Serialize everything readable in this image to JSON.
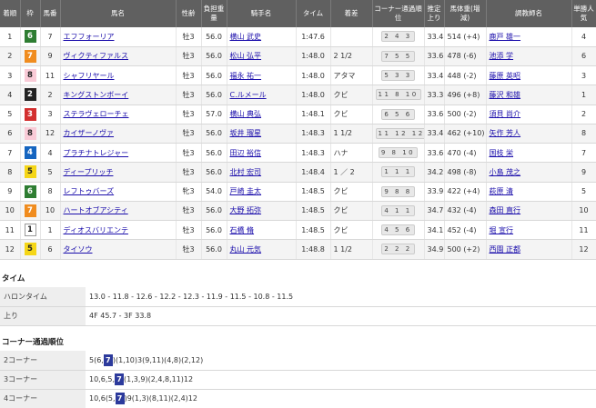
{
  "headers": [
    "着順",
    "枠",
    "馬番",
    "馬名",
    "性齢",
    "負担重量",
    "騎手名",
    "タイム",
    "着差",
    "コーナー通過順位",
    "推定上り",
    "馬体重(増減)",
    "調教師名",
    "単勝人気"
  ],
  "rows": [
    {
      "rank": "1",
      "frame": "6",
      "num": "7",
      "horse": "エフフォーリア",
      "sexage": "牡3",
      "weight": "56.0",
      "jockey": "横山 武史",
      "time": "1:47.6",
      "margin": "",
      "corner": "2 4 3",
      "last": "33.4",
      "body": "514 (+4)",
      "trainer": "鹿戸 雄一",
      "pop": "4"
    },
    {
      "rank": "2",
      "frame": "7",
      "num": "9",
      "horse": "ヴィクティファルス",
      "sexage": "牡3",
      "weight": "56.0",
      "jockey": "松山 弘平",
      "time": "1:48.0",
      "margin": "2 1/2",
      "corner": "7 5 5",
      "last": "33.6",
      "body": "478 (-6)",
      "trainer": "池添 学",
      "pop": "6"
    },
    {
      "rank": "3",
      "frame": "8",
      "num": "11",
      "horse": "シャフリヤール",
      "sexage": "牡3",
      "weight": "56.0",
      "jockey": "福永 祐一",
      "time": "1:48.0",
      "margin": "アタマ",
      "corner": "5 3 3",
      "last": "33.4",
      "body": "448 (-2)",
      "trainer": "藤原 英昭",
      "pop": "3"
    },
    {
      "rank": "4",
      "frame": "2",
      "num": "2",
      "horse": "キングストンボーイ",
      "sexage": "牡3",
      "weight": "56.0",
      "jockey": "C.ルメール",
      "time": "1:48.0",
      "margin": "クビ",
      "corner": "11 8 10",
      "last": "33.3",
      "body": "496 (+8)",
      "trainer": "藤沢 和雄",
      "pop": "1"
    },
    {
      "rank": "5",
      "frame": "3",
      "num": "3",
      "horse": "ステラヴェローチェ",
      "sexage": "牡3",
      "weight": "57.0",
      "jockey": "横山 典弘",
      "time": "1:48.1",
      "margin": "クビ",
      "corner": "6 5 6",
      "last": "33.6",
      "body": "500 (-2)",
      "trainer": "須貝 尚介",
      "pop": "2"
    },
    {
      "rank": "6",
      "frame": "8",
      "num": "12",
      "horse": "カイザーノヴァ",
      "sexage": "牡3",
      "weight": "56.0",
      "jockey": "坂井 瑠星",
      "time": "1:48.3",
      "margin": "1 1/2",
      "corner": "11 12 12",
      "last": "33.4",
      "body": "462 (+10)",
      "trainer": "矢作 芳人",
      "pop": "8"
    },
    {
      "rank": "7",
      "frame": "4",
      "num": "4",
      "horse": "プラチナトレジャー",
      "sexage": "牡3",
      "weight": "56.0",
      "jockey": "田辺 裕信",
      "time": "1:48.3",
      "margin": "ハナ",
      "corner": "9 8 10",
      "last": "33.6",
      "body": "470 (-4)",
      "trainer": "国枝 栄",
      "pop": "7"
    },
    {
      "rank": "8",
      "frame": "5",
      "num": "5",
      "horse": "ディープリッチ",
      "sexage": "牡3",
      "weight": "56.0",
      "jockey": "北村 宏司",
      "time": "1:48.4",
      "margin": "1 ／ 2",
      "corner": "1 1 1",
      "last": "34.2",
      "body": "498 (-8)",
      "trainer": "小島 茂之",
      "pop": "9"
    },
    {
      "rank": "9",
      "frame": "6",
      "num": "8",
      "horse": "レフトゥバーズ",
      "sexage": "牝3",
      "weight": "54.0",
      "jockey": "戸崎 圭太",
      "time": "1:48.5",
      "margin": "クビ",
      "corner": "9 8 8",
      "last": "33.9",
      "body": "422 (+4)",
      "trainer": "萩原 清",
      "pop": "5"
    },
    {
      "rank": "10",
      "frame": "7",
      "num": "10",
      "horse": "ハートオブアシティ",
      "sexage": "牡3",
      "weight": "56.0",
      "jockey": "大野 拓弥",
      "time": "1:48.5",
      "margin": "クビ",
      "corner": "4 1 1",
      "last": "34.7",
      "body": "432 (-4)",
      "trainer": "森田 直行",
      "pop": "10"
    },
    {
      "rank": "11",
      "frame": "1",
      "num": "1",
      "horse": "ディオスバリエンテ",
      "sexage": "牡3",
      "weight": "56.0",
      "jockey": "石橋 脩",
      "time": "1:48.5",
      "margin": "クビ",
      "corner": "4 5 6",
      "last": "34.1",
      "body": "452 (-4)",
      "trainer": "堀 宣行",
      "pop": "11"
    },
    {
      "rank": "12",
      "frame": "5",
      "num": "6",
      "horse": "タイソウ",
      "sexage": "牡3",
      "weight": "56.0",
      "jockey": "丸山 元気",
      "time": "1:48.8",
      "margin": "1 1/2",
      "corner": "2 2 2",
      "last": "34.9",
      "body": "500 (+2)",
      "trainer": "西園 正都",
      "pop": "12"
    }
  ],
  "time_section": {
    "title": "タイム",
    "halon_label": "ハロンタイム",
    "halon_value": "13.0 - 11.8 - 12.6 - 12.2 - 12.3 - 11.9 - 11.5 - 10.8 - 11.5",
    "agari_label": "上り",
    "agari_value": "4F 45.7 - 3F 33.8"
  },
  "corner_section": {
    "title": "コーナー通過順位",
    "rows": [
      {
        "label": "2コーナー",
        "pre": "5(6,",
        "hl": "7",
        "post": ")(1,10)3(9,11)(4,8)(2,12)"
      },
      {
        "label": "3コーナー",
        "pre": "10,6,5,",
        "hl": "7",
        "post": "(1,3,9)(2,4,8,11)12"
      },
      {
        "label": "4コーナー",
        "pre": "10,6(5,",
        "hl": "7",
        "post": ")9(1,3)(8,11)(2,4)12"
      }
    ]
  }
}
